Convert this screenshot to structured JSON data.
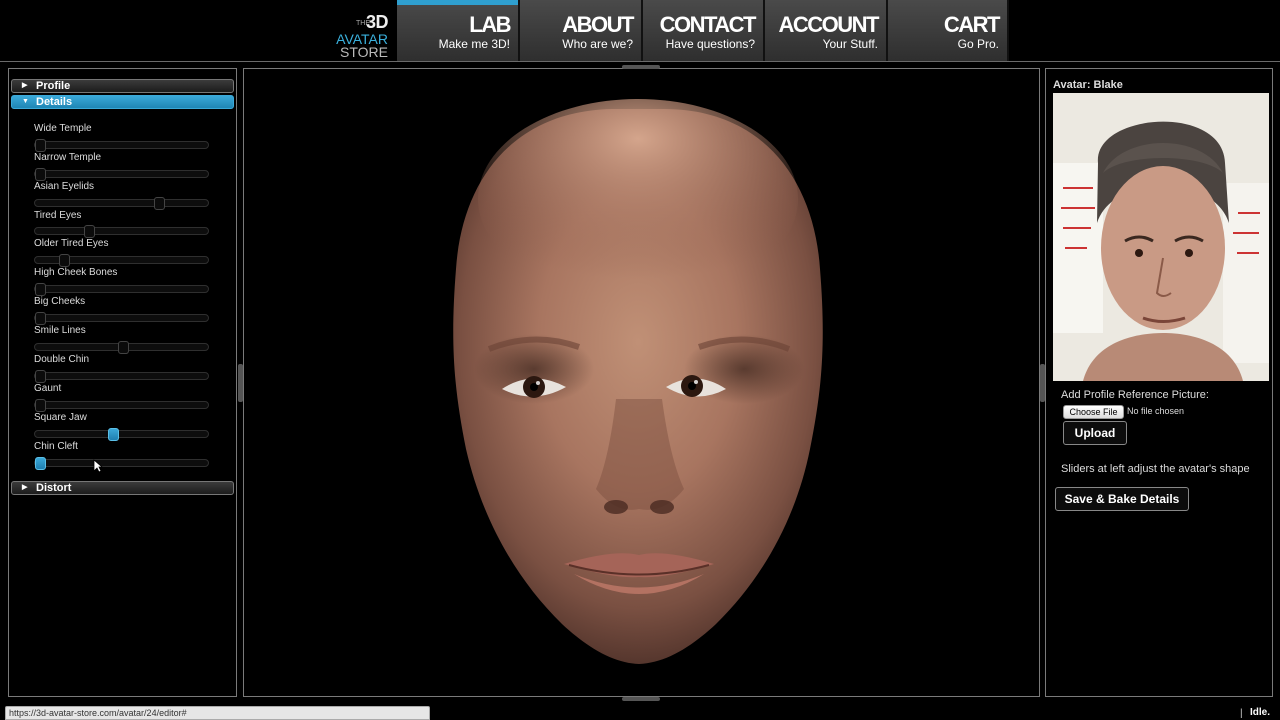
{
  "logo": {
    "the": "THE",
    "three_d": "3D",
    "avatar": "AVATAR",
    "store": "STORE"
  },
  "nav": [
    {
      "title": "LAB",
      "subtitle": "Make me 3D!"
    },
    {
      "title": "ABOUT",
      "subtitle": "Who are we?"
    },
    {
      "title": "CONTACT",
      "subtitle": "Have questions?"
    },
    {
      "title": "ACCOUNT",
      "subtitle": "Your Stuff."
    },
    {
      "title": "CART",
      "subtitle": "Go Pro."
    }
  ],
  "accordion": {
    "profile_label": "Profile",
    "details_label": "Details",
    "distort_label": "Distort"
  },
  "sliders": [
    {
      "label": "Wide Temple",
      "value": 0.0,
      "active": false
    },
    {
      "label": "Narrow Temple",
      "value": 0.0,
      "active": false
    },
    {
      "label": "Asian Eyelids",
      "value": 0.73,
      "active": false
    },
    {
      "label": "Tired Eyes",
      "value": 0.3,
      "active": false
    },
    {
      "label": "Older Tired Eyes",
      "value": 0.15,
      "active": false
    },
    {
      "label": "High Cheek Bones",
      "value": 0.0,
      "active": false
    },
    {
      "label": "Big Cheeks",
      "value": 0.0,
      "active": false
    },
    {
      "label": "Smile Lines",
      "value": 0.51,
      "active": false
    },
    {
      "label": "Double Chin",
      "value": 0.0,
      "active": false
    },
    {
      "label": "Gaunt",
      "value": 0.0,
      "active": false
    },
    {
      "label": "Square Jaw",
      "value": 0.45,
      "active": true
    },
    {
      "label": "Chin Cleft",
      "value": 0.0,
      "active": true
    }
  ],
  "right_panel": {
    "avatar_title": "Avatar: Blake",
    "ref_label": "Add Profile Reference Picture:",
    "choose_file_label": "Choose File",
    "no_file_label": "No file chosen",
    "upload_label": "Upload",
    "hint": "Sliders at left adjust the avatar's shape",
    "save_label": "Save & Bake Details"
  },
  "status": {
    "url": "https://3d-avatar-store.com/avatar/24/editor#",
    "separator": "|",
    "state": "Idle."
  },
  "colors": {
    "accent": "#2f9fcf",
    "nav_bg": "#3a3a3a",
    "panel_border": "#7a7a7a"
  }
}
